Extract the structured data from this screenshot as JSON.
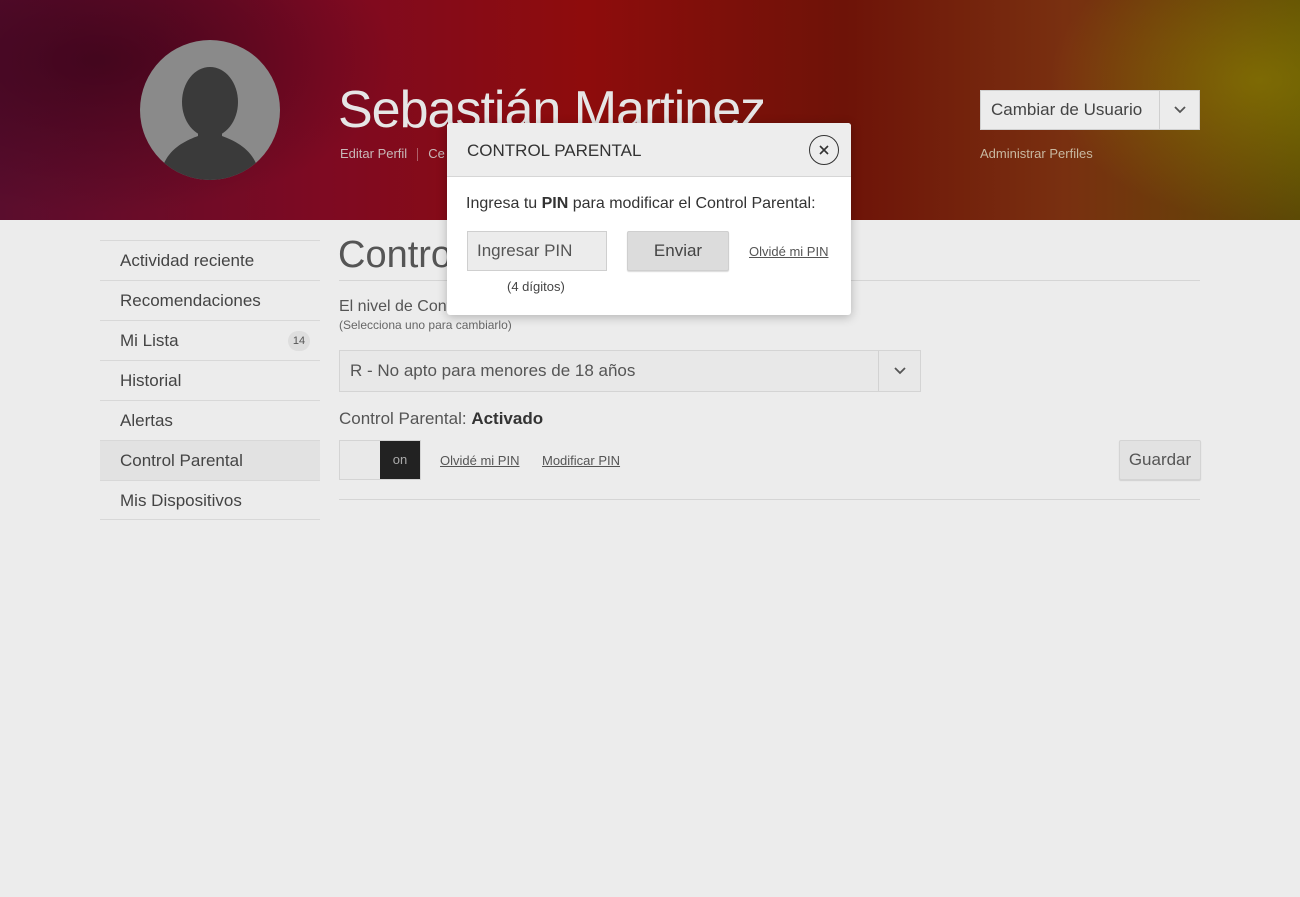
{
  "header": {
    "user_name": "Sebastián Martinez",
    "links": [
      "Editar Perfil",
      "Ce"
    ],
    "switch_user_label": "Cambiar de Usuario",
    "admin_profiles": "Administrar Perfiles"
  },
  "sidebar": {
    "items": [
      {
        "label": "Actividad reciente"
      },
      {
        "label": "Recomendaciones"
      },
      {
        "label": "Mi Lista",
        "badge": "14"
      },
      {
        "label": "Historial"
      },
      {
        "label": "Alertas"
      },
      {
        "label": "Control Parental",
        "active": true
      },
      {
        "label": "Mis Dispositivos"
      }
    ]
  },
  "main": {
    "title": "Control",
    "level_label": "El nivel de Cont",
    "level_hint": "(Selecciona uno para cambiarlo)",
    "rating_selected": "R - No apto para menores de 18 años",
    "status_prefix": "Control Parental:",
    "status_value": "Activado",
    "toggle_label": "on",
    "forgot_pin": "Olvidé mi PIN",
    "modify_pin": "Modificar PIN",
    "save": "Guardar"
  },
  "modal": {
    "title": "CONTROL PARENTAL",
    "prompt_before": "Ingresa tu ",
    "prompt_bold": "PIN",
    "prompt_after": " para modificar el Control Parental:",
    "pin_placeholder": "Ingresar PIN",
    "pin_hint": "(4 dígitos)",
    "send": "Enviar",
    "forgot_pin": "Olvidé mi PIN"
  },
  "colors": {
    "background": "#ececec",
    "toggle_knob": "#222222"
  },
  "icons": [
    "avatar-silhouette",
    "chevron-down-icon",
    "close-icon"
  ]
}
